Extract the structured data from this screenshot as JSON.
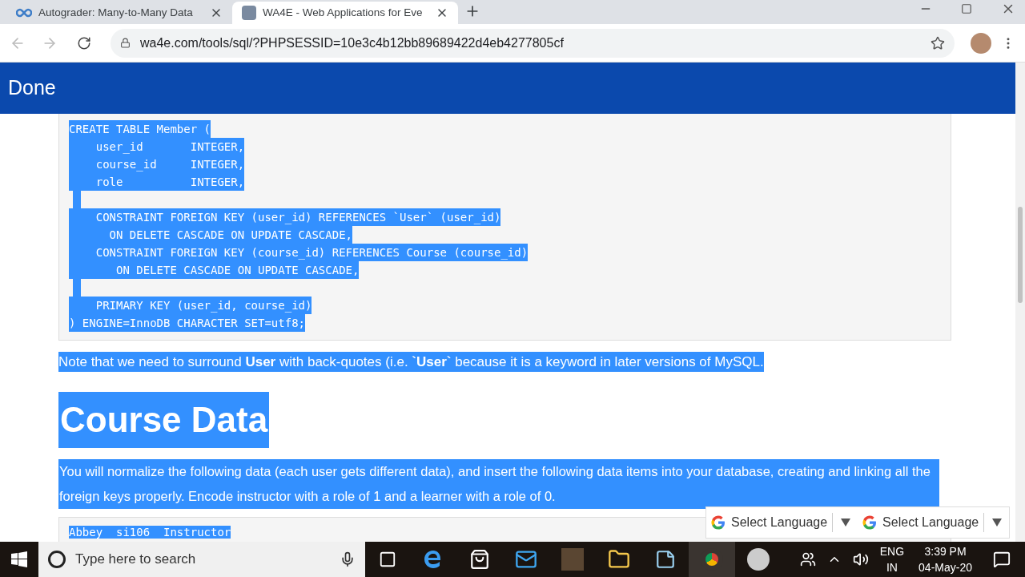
{
  "browser": {
    "tabs": [
      {
        "title": "Autograder: Many-to-Many Data",
        "selected": false,
        "kind": "autograder"
      },
      {
        "title": "WA4E - Web Applications for Eve",
        "selected": true,
        "kind": "wa4e"
      }
    ],
    "url": "wa4e.com/tools/sql/?PHPSESSID=10e3c4b12bb89689422d4eb4277805cf"
  },
  "page": {
    "header": "Done",
    "text_selected": true,
    "code_block": [
      {
        "kind": "code",
        "text": "CREATE TABLE Member ("
      },
      {
        "kind": "code",
        "text": "    user_id       INTEGER,"
      },
      {
        "kind": "code",
        "text": "    course_id     INTEGER,"
      },
      {
        "kind": "code",
        "text": "    role          INTEGER,"
      },
      {
        "kind": "blank"
      },
      {
        "kind": "code",
        "text": "    CONSTRAINT FOREIGN KEY (user_id) REFERENCES `User` (user_id)"
      },
      {
        "kind": "code",
        "text": "      ON DELETE CASCADE ON UPDATE CASCADE,"
      },
      {
        "kind": "code",
        "text": "    CONSTRAINT FOREIGN KEY (course_id) REFERENCES Course (course_id)"
      },
      {
        "kind": "code",
        "text": "       ON DELETE CASCADE ON UPDATE CASCADE,"
      },
      {
        "kind": "blank"
      },
      {
        "kind": "code",
        "text": "    PRIMARY KEY (user_id, course_id)"
      },
      {
        "kind": "code",
        "text": ") ENGINE=InnoDB CHARACTER SET=utf8;"
      }
    ],
    "note": "Note that we need to surround **User** with back-quotes (i.e. **`User`** because it is a keyword in later versions of MySQL.",
    "heading": "Course Data",
    "paragraph": "You will normalize the following data (each user gets different data), and insert the following data items into your database, creating and linking all the foreign keys properly. Encode instructor with a role of 1 and a learner with a role of 0.",
    "data_block": [
      "Abbey  si106  Instructor"
    ],
    "translate": [
      "Select Language",
      "Select Language"
    ]
  },
  "taskbar": {
    "search_placeholder": "Type here to search",
    "language": "ENG",
    "region": "IN",
    "time": "3:39 PM",
    "date": "04-May-20"
  }
}
